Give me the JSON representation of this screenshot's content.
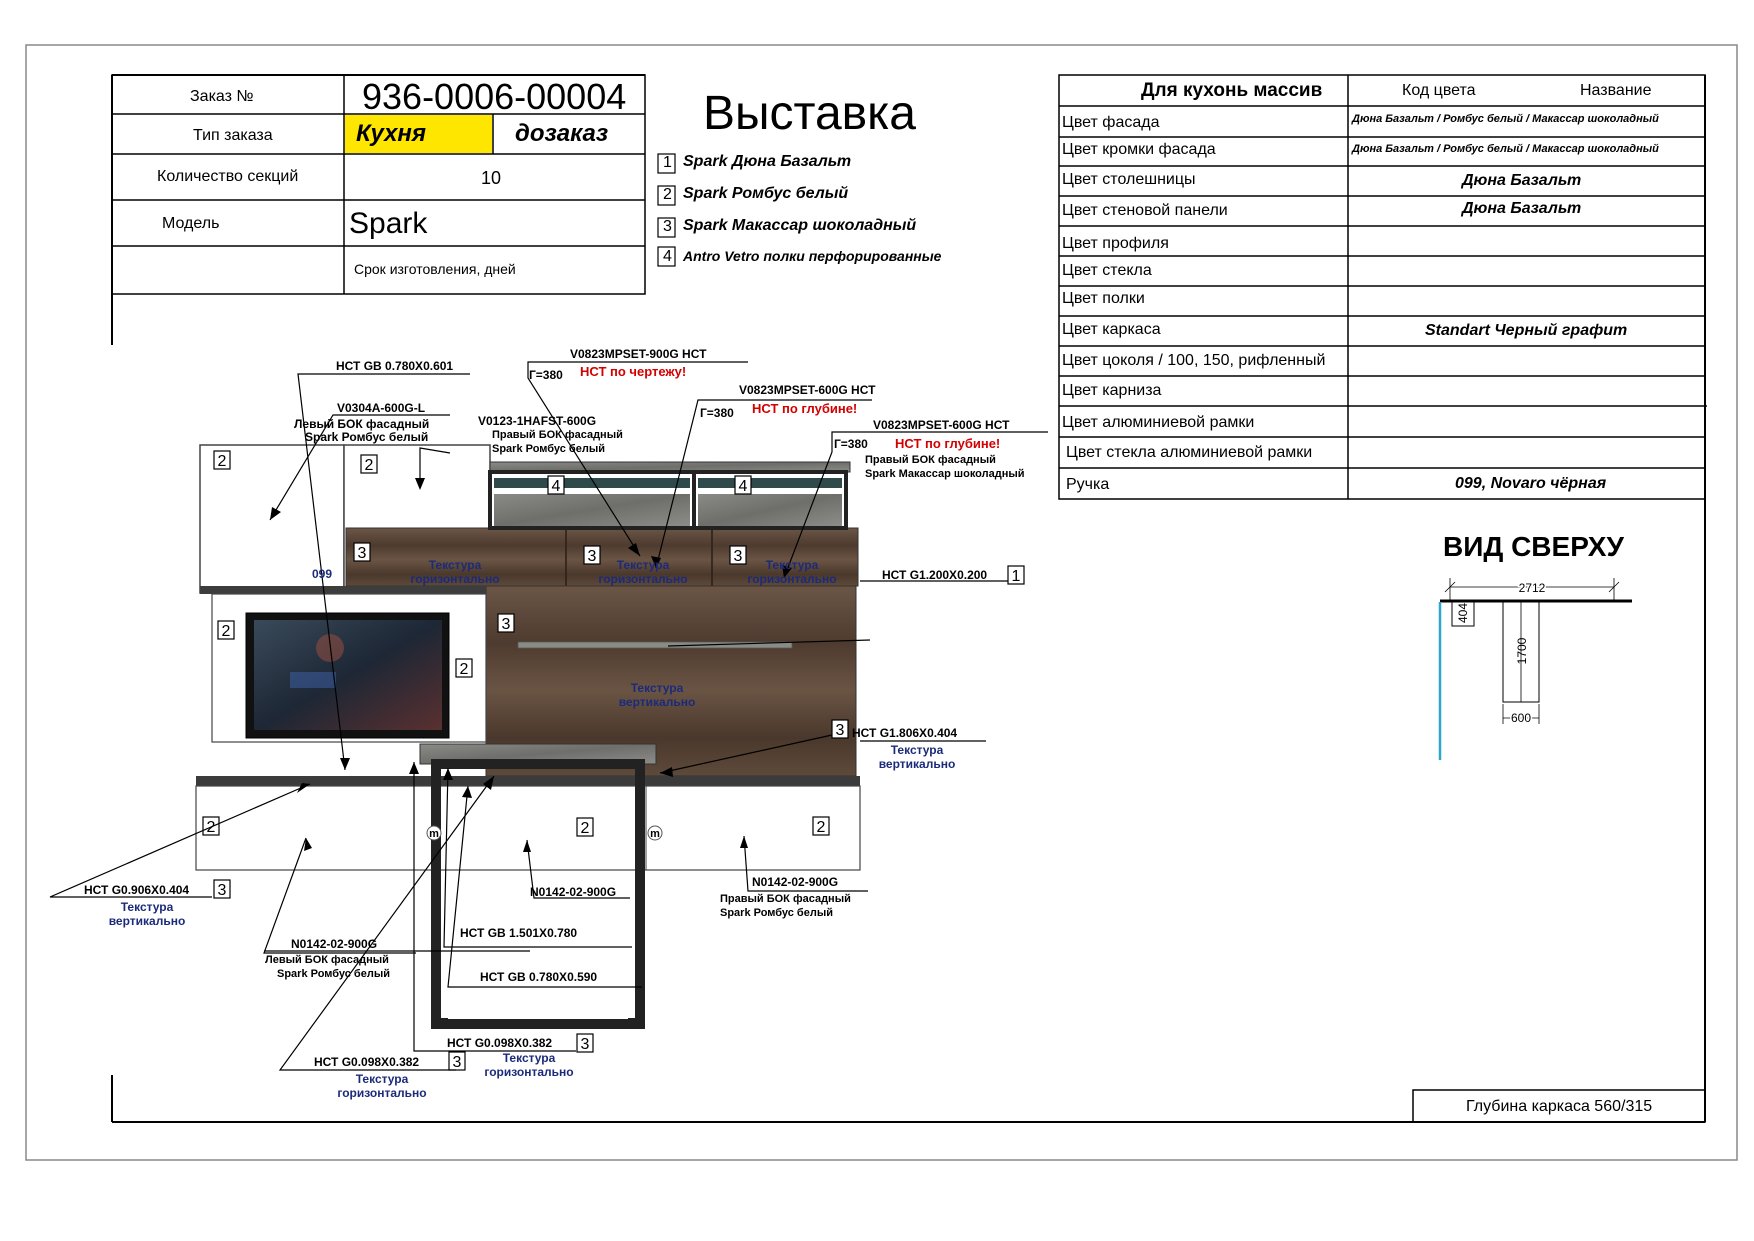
{
  "order": {
    "label_order": "Заказ №",
    "order_number": "936-0006-00004",
    "label_type": "Тип заказа",
    "type_value": "Кухня",
    "type_extra": "дозаказ",
    "label_sections": "Количество секций",
    "sections": "10",
    "label_model": "Модель",
    "model": "Spark",
    "label_term": "Срок изготовления, дней"
  },
  "title": "Выставка",
  "materials": [
    {
      "num": "1",
      "text": "Spark Дюна Базальт"
    },
    {
      "num": "2",
      "text": "Spark Ромбус белый"
    },
    {
      "num": "3",
      "text": "Spark Макассар шоколадный"
    },
    {
      "num": "4",
      "text": "Antro Vetro полки перфорированные"
    }
  ],
  "colors_table": {
    "head_left": "Для кухонь массив",
    "head_code": "Код цвета",
    "head_name": "Название",
    "rows": [
      {
        "label": "Цвет фасада",
        "value": "Дюна Базальт / Ромбус белый / Макассар шоколадный"
      },
      {
        "label": "Цвет кромки фасада",
        "value": "Дюна Базальт / Ромбус белый / Макассар шоколадный"
      },
      {
        "label": "Цвет столешницы",
        "value": "Дюна Базальт"
      },
      {
        "label": "Цвет стеновой панели",
        "value": "Дюна Базальт"
      },
      {
        "label": "Цвет профиля",
        "value": ""
      },
      {
        "label": "Цвет стекла",
        "value": ""
      },
      {
        "label": "Цвет полки",
        "value": ""
      },
      {
        "label": "Цвет каркаса",
        "value": "Standart Черный графит"
      },
      {
        "label": "Цвет цоколя / 100, 150, рифленный",
        "value": ""
      },
      {
        "label": "Цвет карниза",
        "value": ""
      },
      {
        "label": "Цвет алюминиевой рамки",
        "value": ""
      },
      {
        "label": "Цвет стекла алюминиевой рамки",
        "value": ""
      },
      {
        "label": "Ручка",
        "value": "099, Novaro чёрная"
      }
    ]
  },
  "top_view": {
    "title": "ВИД СВЕРХУ",
    "dims": {
      "width": "2712",
      "depth": "404",
      "length": "1700",
      "leg": "600"
    }
  },
  "footer": "Глубина каркаса 560/315",
  "annotations": {
    "a1": "НСТ GB 0.780X0.601",
    "a2": "V0304A-600G-L",
    "a2_desc1": "Левый БОК фасадный",
    "a2_desc2": "Spark Ромбус белый",
    "a3_g": "Г=380",
    "a3_red": "НСТ по чертежу!",
    "a3_code": "V0823MPSET-900G НСТ",
    "a4": "V0123-1HAFST-600G",
    "a4_desc1": "Правый БОК фасадный",
    "a4_desc2": "Spark Ромбус белый",
    "a5_code": "V0823MPSET-600G НСТ",
    "a5_g": "Г=380",
    "a5_red": "НСТ по глубине!",
    "a6_code": "V0823MPSET-600G НСТ",
    "a6_g": "Г=380",
    "a6_red": "НСТ по глубине!",
    "a6_desc1": "Правый БОК фасадный",
    "a6_desc2": "Spark Макассар шоколадный",
    "handle": "099",
    "tex1": "Текстура",
    "tex_h": "горизонтально",
    "tex_v": "вертикально",
    "a7": "НСТ G1.200X0.200",
    "a8": "НСТ G1.806X0.404",
    "a9": "НСТ G0.906X0.404",
    "a10": "N0142-02-900G",
    "a10_desc1": "Левый БОК фасадный",
    "a10_desc2": "Spark Ромбус белый",
    "a11": "N0142-02-900G",
    "a12": "N0142-02-900G",
    "a12_desc1": "Правый БОК фасадный",
    "a12_desc2": "Spark Ромбус белый",
    "a13": "НСТ GB 1.501X0.780",
    "a14": "НСТ GB 0.780X0.590",
    "a15": "НСТ G0.098X0.382",
    "a16": "НСТ G0.098X0.382",
    "m": "m"
  },
  "colors": {
    "kitchen_highlight": "#ffe600",
    "wood_dark": "#5a4638",
    "frame_black": "#222222",
    "red_note": "#d40000",
    "blue_note": "#1c2a7a",
    "cyan_line": "#2aa7c9"
  }
}
